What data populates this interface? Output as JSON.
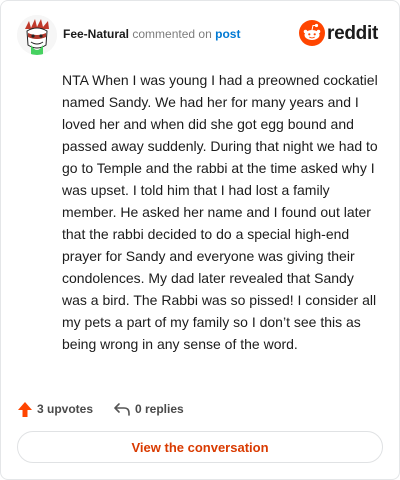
{
  "header": {
    "username": "Fee-Natural",
    "commented_on": "commented on",
    "post_link": "post",
    "brand": "reddit"
  },
  "comment": {
    "text": "NTA When I was young I had a preowned cockatiel named Sandy. We had her for many years and I loved her and when did she got egg bound and passed away suddenly. During that night we had to go to Temple and the rabbi at the time asked why I was upset. I told him that I had lost a family member. He asked her name and I found out later that the rabbi decided to do a special high-end prayer for Sandy and everyone was giving their condolences. My dad later revealed that Sandy was a bird. The Rabbi was so pissed! I consider all my pets a part of my family so I don’t see this as being wrong in any sense of the word."
  },
  "actions": {
    "upvotes": "3 upvotes",
    "replies": "0 replies"
  },
  "cta": {
    "label": "View the conversation"
  },
  "colors": {
    "brand": "#ff4500",
    "link": "#0079d3",
    "cta": "#d93a00"
  },
  "icons": [
    "avatar",
    "reddit-logo-icon",
    "upvote-arrow-icon",
    "reply-icon"
  ]
}
